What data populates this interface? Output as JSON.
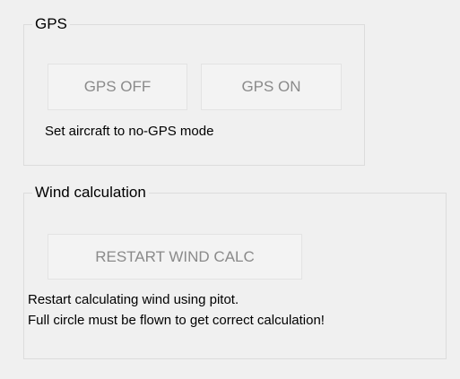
{
  "gps_group": {
    "title": "GPS",
    "off_button": "GPS OFF",
    "on_button": "GPS ON",
    "description": "Set aircraft to no-GPS mode"
  },
  "wind_group": {
    "title": "Wind calculation",
    "restart_button": "RESTART WIND CALC",
    "description_line1": "Restart calculating wind using pitot.",
    "description_line2": "Full circle must be flown to get correct calculation!"
  }
}
